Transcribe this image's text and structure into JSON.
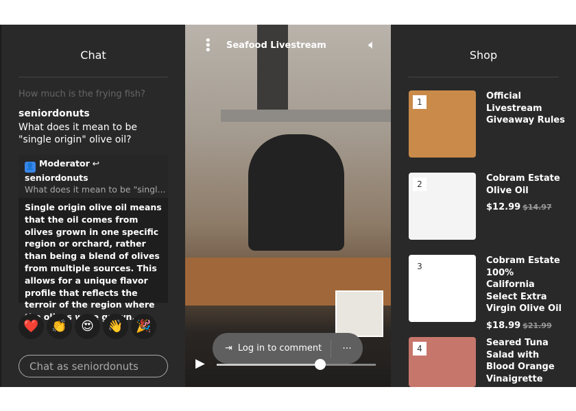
{
  "chat": {
    "title": "Chat",
    "faded_message": "How much is the frying fish?",
    "username": "seniordonuts",
    "message": "What does it mean to be \"single origin\" olive oil?",
    "moderator": {
      "label": "Moderator",
      "reply_to": "seniordonuts",
      "quote": "What does it mean to be \"singl...",
      "answer": "Single origin olive oil means that the oil comes from olives grown in one specific region or orchard, rather than being a blend of olives from multiple sources. This allows for a unique flavor profile that reflects the terroir of the region where the olives were grown."
    },
    "reactions": [
      {
        "name": "heart",
        "glyph": "❤️"
      },
      {
        "name": "clap",
        "glyph": "👏"
      },
      {
        "name": "heart-eyes",
        "glyph": "😍"
      },
      {
        "name": "wave",
        "glyph": "👋"
      },
      {
        "name": "party",
        "glyph": "🎉"
      }
    ],
    "input_placeholder": "Chat as seniordonuts"
  },
  "video": {
    "title": "Seafood Livestream",
    "login_label": "Log in to comment",
    "more_label": "···",
    "progress_percent": 65
  },
  "shop": {
    "title": "Shop",
    "items": [
      {
        "num": "1",
        "name": "Official Livestream Giveaway Rules",
        "price": "",
        "old_price": "",
        "color": "#c98a4a"
      },
      {
        "num": "2",
        "name": "Cobram Estate Olive Oil",
        "price": "$12.99",
        "old_price": "$14.97",
        "color": "#f4f4f4"
      },
      {
        "num": "3",
        "name": "Cobram Estate 100% California Select Extra Virgin Olive Oil",
        "price": "$18.99",
        "old_price": "$21.99",
        "color": "#ffffff"
      },
      {
        "num": "4",
        "name": "Seared Tuna Salad with Blood Orange Vinaigrette",
        "price": "",
        "old_price": "",
        "color": "#c7766c"
      }
    ]
  }
}
